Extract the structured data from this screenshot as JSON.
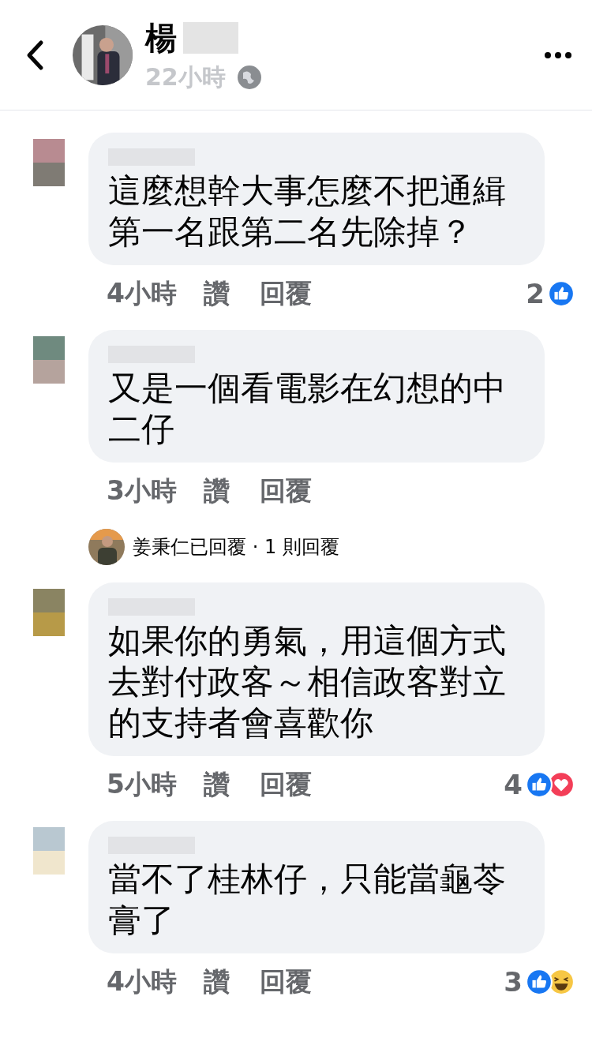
{
  "header": {
    "name": "楊",
    "time": "22小時"
  },
  "comments": [
    {
      "text": "這麼想幹大事怎麼不把通緝第一名跟第二名先除掉？",
      "time": "4小時",
      "like": "讚",
      "reply": "回覆",
      "reaction_count": "2",
      "reactions": [
        {
          "kind": "like"
        }
      ]
    },
    {
      "text": "又是一個看電影在幻想的中二仔",
      "time": "3小時",
      "like": "讚",
      "reply": "回覆",
      "replies": "姜秉仁已回覆 · 1 則回覆"
    },
    {
      "text": "如果你的勇氣，用這個方式去對付政客～相信政客對立的支持者會喜歡你",
      "time": "5小時",
      "like": "讚",
      "reply": "回覆",
      "reaction_count": "4",
      "reactions": [
        {
          "kind": "like"
        },
        {
          "kind": "love"
        }
      ]
    },
    {
      "text": "當不了桂林仔，只能當龜苓膏了",
      "time": "4小時",
      "like": "讚",
      "reply": "回覆",
      "reaction_count": "3",
      "reactions": [
        {
          "kind": "like"
        },
        {
          "kind": "haha"
        }
      ]
    }
  ]
}
